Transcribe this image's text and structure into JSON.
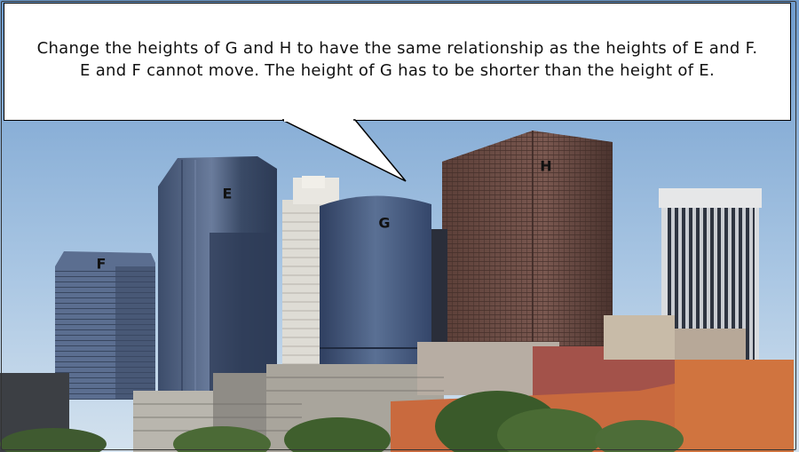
{
  "bubble": {
    "text": "Change the heights of G and H to have the same relationship as the heights of E and F. E and F cannot move. The height of G has to be shorter than the height of E."
  },
  "labels": {
    "e": "E",
    "f": "F",
    "g": "G",
    "h": "H"
  },
  "colors": {
    "sky": "#8fb4d9",
    "glass_tower": "#4a5a78",
    "brown_tower": "#6b4c44",
    "brick": "#c86a40"
  }
}
